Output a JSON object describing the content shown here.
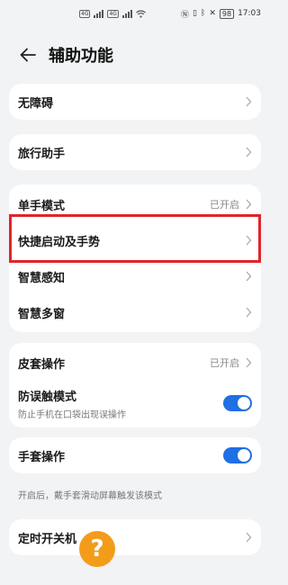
{
  "status_bar": {
    "sim1": "4G",
    "sim2": "4G",
    "battery": "98",
    "time": "17:03"
  },
  "header": {
    "back_icon": "arrow-left-icon",
    "title": "辅助功能"
  },
  "sections": {
    "accessibility": {
      "label": "无障碍"
    },
    "travel_assistant": {
      "label": "旅行助手"
    },
    "one_hand_mode": {
      "label": "单手模式",
      "state": "已开启"
    },
    "shortcuts_gestures": {
      "label": "快捷启动及手势"
    },
    "smart_perception": {
      "label": "智慧感知"
    },
    "smart_multiwindow": {
      "label": "智慧多窗"
    },
    "cover_operation": {
      "label": "皮套操作",
      "state": "已开启"
    },
    "accidental_touch": {
      "label": "防误触模式",
      "sub": "防止手机在口袋出现误操作",
      "enabled": true
    },
    "glove_mode": {
      "label": "手套操作",
      "enabled": true
    },
    "glove_note": "开启后，戴手套滑动屏幕触发该模式",
    "scheduled_power": {
      "label": "定时开关机"
    }
  },
  "colors": {
    "accent": "#1f6fe5",
    "highlight": "#e0242b",
    "help": "#f39c1a"
  },
  "help_fab": {
    "symbol": "?"
  }
}
